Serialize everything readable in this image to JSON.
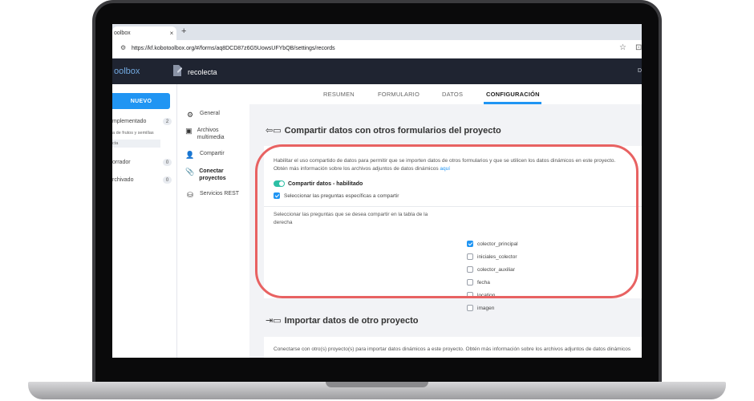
{
  "browser": {
    "tab_title": "oolbox",
    "tab_close": "×",
    "new_tab": "+",
    "url": "https://kf.kobotoolbox.org/#/forms/aq8DCD87z6G5UowsUFYbQB/settings/records",
    "site_icon": "tune-icon",
    "star": "☆",
    "extensions": "⊡"
  },
  "header": {
    "brand": "oolbox",
    "project_name": "recolecta",
    "right_text": "D"
  },
  "sidebar": {
    "new_button": "NUEVO",
    "deployed_label": "mplementado",
    "deployed_count": "2",
    "deployed_projects": [
      "a de frutos y semillas",
      "cta"
    ],
    "draft_label": "orrador",
    "draft_count": "0",
    "archived_label": "rchivado",
    "archived_count": "0"
  },
  "top_tabs": [
    "RESUMEN",
    "FORMULARIO",
    "DATOS",
    "CONFIGURACIÓN"
  ],
  "settings_nav": [
    {
      "label": "General",
      "icon": "gear-icon"
    },
    {
      "label": "Archivos multimedia",
      "icon": "image-icon"
    },
    {
      "label": "Compartir",
      "icon": "user-plus-icon"
    },
    {
      "label": "Conectar proyectos",
      "icon": "paperclip-icon"
    },
    {
      "label": "Servicios REST",
      "icon": "rest-icon"
    }
  ],
  "share_section": {
    "title": "Compartir datos con otros formularios del proyecto",
    "description_1": "Habilitar el uso compartido de datos para permitir que se importen datos de otros formularios y que se utilicen los datos dinámicos en este proyecto.",
    "description_2": "Obtén más información sobre los archivos adjuntos de datos dinámicos",
    "link": "aquí",
    "toggle_label": "Compartir datos - habilitado",
    "specific_label": "Seleccionar las preguntas específicas a compartir",
    "select_label": "Seleccionar las preguntas que se desea compartir en la tabla de la derecha",
    "questions": [
      {
        "name": "colector_principal",
        "checked": true
      },
      {
        "name": "iniciales_colector",
        "checked": false
      },
      {
        "name": "colector_auxiliar",
        "checked": false
      },
      {
        "name": "fecha",
        "checked": false
      },
      {
        "name": "location",
        "checked": false
      },
      {
        "name": "imagen",
        "checked": false
      }
    ]
  },
  "import_section": {
    "title": "Importar datos de otro proyecto",
    "description": "Conectarse con otro(s) proyecto(s) para importar datos dinámicos a este proyecto. Obtén más información sobre los archivos adjuntos de datos dinámicos"
  },
  "colors": {
    "accent": "#2095f3",
    "header_bg": "#1f2431",
    "toggle_on": "#2dbfa5",
    "highlight": "#e86262"
  }
}
